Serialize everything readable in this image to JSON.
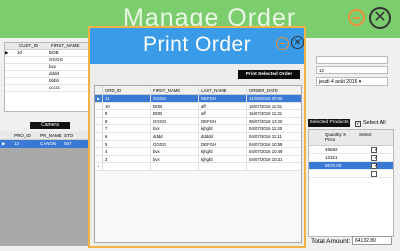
{
  "app": {
    "title": "Manage Order",
    "close_glyph": "✕"
  },
  "customers_grid": {
    "headers": [
      "CUST_ID",
      "FIRST_NAME"
    ],
    "rows": [
      {
        "marker": "▶",
        "id": "10",
        "name": "BOB"
      },
      {
        "marker": "",
        "id": "",
        "name": "GGGG"
      },
      {
        "marker": "",
        "id": "",
        "name": "bvx"
      },
      {
        "marker": "",
        "id": "",
        "name": "dddd"
      },
      {
        "marker": "",
        "id": "",
        "name": "bbbb"
      },
      {
        "marker": "",
        "id": "",
        "name": "ccccc"
      }
    ]
  },
  "products": {
    "category_label": "Camera",
    "headers": [
      "PRO_ID",
      "PR_NAME",
      "STO"
    ],
    "row": {
      "marker": "▶",
      "id": "12",
      "name": "CANON",
      "stock": "567"
    }
  },
  "right_panel": {
    "field_value": "12",
    "date_value": "jeudi   4   août   2016 ▾",
    "selected_products_label": "Selected Products",
    "select_all_label": "Select All",
    "select_all_check": "✓",
    "headers": [
      "",
      "Quantity X Price",
      "Select"
    ],
    "rows": [
      {
        "a": "",
        "b": "45692",
        "check": "✓",
        "selected": false
      },
      {
        "a": "",
        "b": "12321",
        "check": "✓",
        "selected": false
      },
      {
        "a": "",
        "b": "5670.00",
        "check": "✓",
        "selected": true
      },
      {
        "a": "",
        "b": "",
        "check": "",
        "selected": false
      }
    ],
    "total_label": "Total Amount:",
    "total_value": "64132.80"
  },
  "modal": {
    "title": "Print Order",
    "close_glyph": "✕",
    "print_button": "Print Selected Order",
    "headers": [
      "ORD_ID",
      "FIRST_NAME",
      "LAST_NAME",
      "ORDER_DATE"
    ],
    "rows": [
      {
        "marker": "▶",
        "id": "11",
        "first": "GGGG",
        "last": "DEFGH",
        "date": "31/08/2016 00:00",
        "selected": true
      },
      {
        "marker": "",
        "id": "10",
        "first": "BOB",
        "last": "aff",
        "date": "15/07/2016 11:51",
        "selected": false
      },
      {
        "marker": "",
        "id": "9",
        "first": "BOB",
        "last": "aff",
        "date": "15/07/2016 11:31",
        "selected": false
      },
      {
        "marker": "",
        "id": "8",
        "first": "GGGG",
        "last": "DEFGH",
        "date": "05/07/2016 13:20",
        "selected": false
      },
      {
        "marker": "",
        "id": "7",
        "first": "bvx",
        "last": "kjhgfd",
        "date": "04/07/2016 11:20",
        "selected": false
      },
      {
        "marker": "",
        "id": "6",
        "first": "dddd",
        "last": "ddddd",
        "date": "04/07/2016 11:11",
        "selected": false
      },
      {
        "marker": "",
        "id": "5",
        "first": "GGGG",
        "last": "DEFGH",
        "date": "04/07/2016 10:59",
        "selected": false
      },
      {
        "marker": "",
        "id": "4",
        "first": "bvx",
        "last": "kjhgfd",
        "date": "04/07/2016 10:49",
        "selected": false
      },
      {
        "marker": "",
        "id": "3",
        "first": "bvx",
        "last": "kjhgfd",
        "date": "04/07/2016 10:31",
        "selected": false
      },
      {
        "marker": "*",
        "id": "",
        "first": "",
        "last": "",
        "date": "",
        "selected": false
      }
    ]
  }
}
